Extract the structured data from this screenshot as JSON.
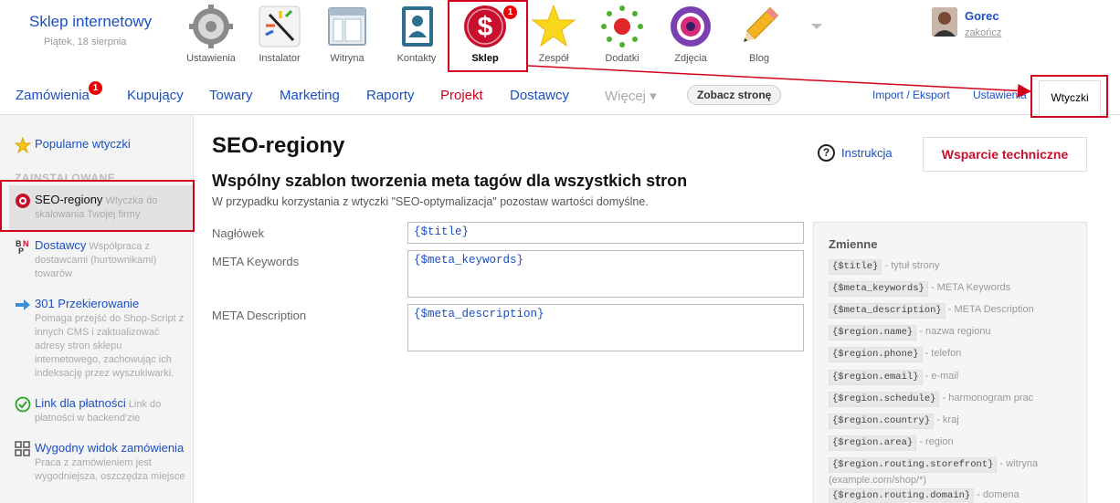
{
  "store": {
    "title": "Sklep internetowy",
    "date": "Piątek, 18 sierpnia"
  },
  "apps": [
    {
      "label": "Ustawienia"
    },
    {
      "label": "Instalator"
    },
    {
      "label": "Witryna"
    },
    {
      "label": "Kontakty"
    },
    {
      "label": "Sklep",
      "badge": "1"
    },
    {
      "label": "Zespół"
    },
    {
      "label": "Dodatki"
    },
    {
      "label": "Zdjęcia"
    },
    {
      "label": "Blog"
    }
  ],
  "user": {
    "name": "Gorec",
    "logout": "zakończ"
  },
  "mainnav": {
    "orders": "Zamówienia",
    "orders_badge": "1",
    "customers": "Kupujący",
    "products": "Towary",
    "marketing": "Marketing",
    "reports": "Raporty",
    "project": "Projekt",
    "suppliers": "Dostawcy",
    "more": "Więcej ▾",
    "see_store": "Zobacz stronę",
    "import_export": "Import / Eksport",
    "settings": "Ustawienia",
    "plugins": "Wtyczki"
  },
  "sidebar": {
    "popular": "Popularne wtyczki",
    "installed_header": "ZAINSTALOWANE",
    "items": [
      {
        "title": "SEO-regiony",
        "desc": "Wtyczka do skalowania Twojej firmy"
      },
      {
        "title": "Dostawcy",
        "desc": "Współpraca z dostawcami (hurtownikami) towarów"
      },
      {
        "title": "301 Przekierowanie",
        "desc": "Pomaga przejść do Shop-Script z innych CMS i zaktualizować adresy stron sklepu internetowego, zachowując ich indeksację przez wyszukiwarki."
      },
      {
        "title": "Link dla płatności",
        "desc": "Link do płatności w backend'zie"
      },
      {
        "title": "Wygodny widok zamówienia",
        "desc": "Praca z zamówieniem jest wygodniejsza, oszczędza miejsce"
      }
    ]
  },
  "content": {
    "title": "SEO-regiony",
    "subtitle": "Wspólny szablon tworzenia meta tagów dla wszystkich stron",
    "description": "W przypadku korzystania z wtyczki \"SEO-optymalizacja\" pozostaw wartości domyślne.",
    "instruction": "Instrukcja",
    "support": "Wsparcie techniczne",
    "fields": {
      "heading_label": "Nagłówek",
      "heading_value": "{$title}",
      "keywords_label": "META Keywords",
      "keywords_value": "{$meta_keywords}",
      "description_label": "META Description",
      "description_value": "{$meta_description}"
    }
  },
  "variables": {
    "header": "Zmienne",
    "items": [
      {
        "code": "{$title}",
        "desc": "- tytuł strony"
      },
      {
        "code": "{$meta_keywords}",
        "desc": "- META Keywords"
      },
      {
        "code": "{$meta_description}",
        "desc": "- META Description"
      },
      {
        "code": "{$region.name}",
        "desc": "- nazwa regionu"
      },
      {
        "code": "{$region.phone}",
        "desc": "- telefon"
      },
      {
        "code": "{$region.email}",
        "desc": "- e-mail"
      },
      {
        "code": "{$region.schedule}",
        "desc": "- harmonogram prac"
      },
      {
        "code": "{$region.country}",
        "desc": "- kraj"
      },
      {
        "code": "{$region.area}",
        "desc": "- region"
      },
      {
        "code": "{$region.routing.storefront}",
        "desc": "- witryna (example.com/shop/*)"
      },
      {
        "code": "{$region.routing.domain}",
        "desc": "- domena (example.com)"
      }
    ]
  },
  "colors": {
    "accent": "#1a4fbf",
    "highlight": "#d0021b",
    "project": "#d0021b"
  }
}
